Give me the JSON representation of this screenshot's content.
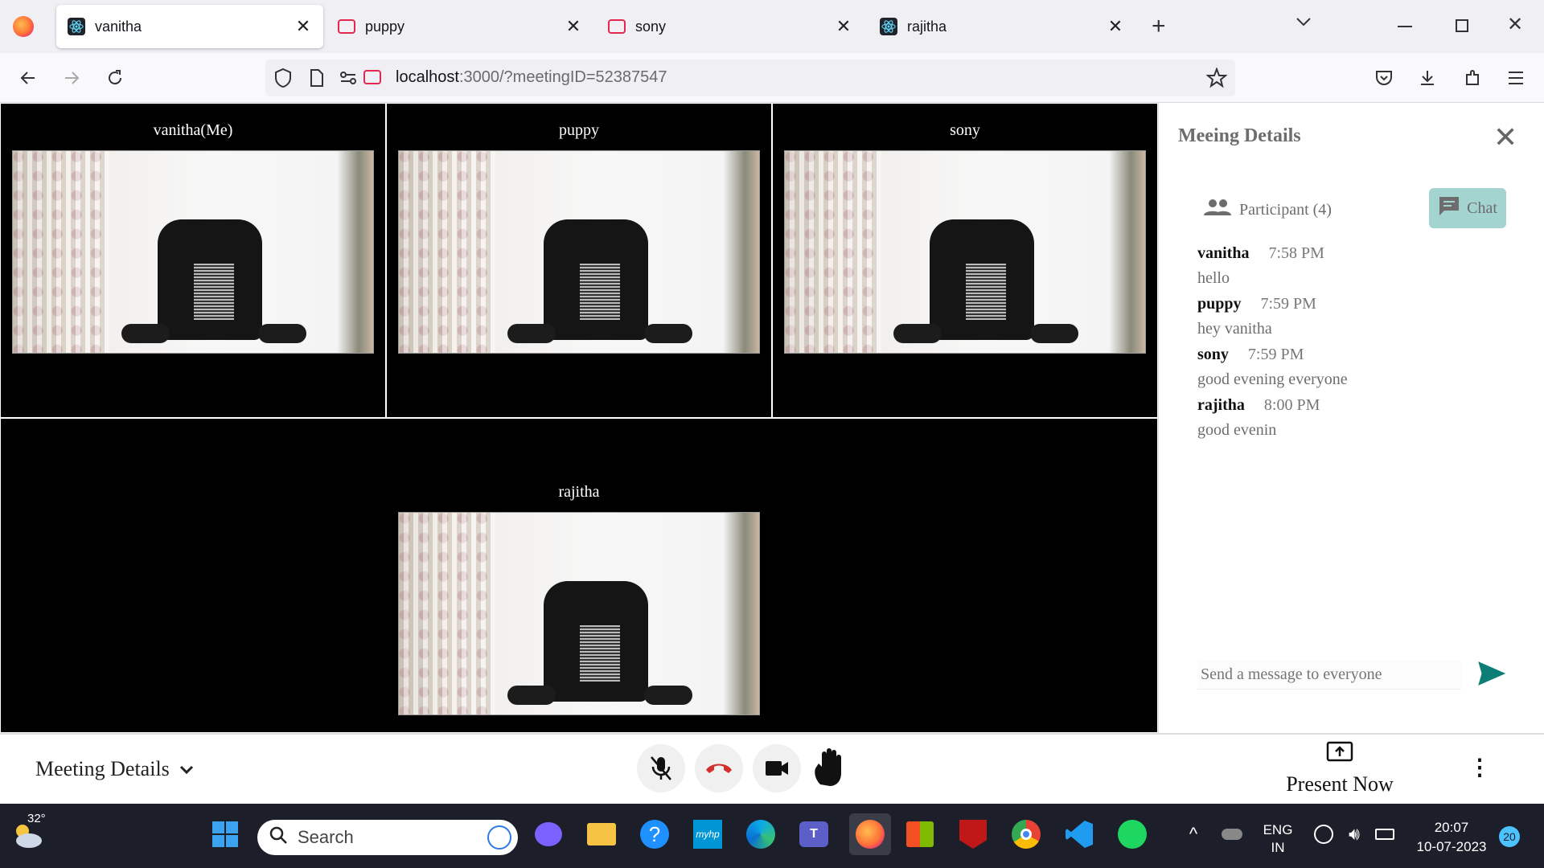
{
  "browser": {
    "tabs": [
      {
        "title": "vanitha",
        "icon": "react-icon",
        "active": true
      },
      {
        "title": "puppy",
        "icon": "camera-icon",
        "active": false
      },
      {
        "title": "sony",
        "icon": "camera-icon",
        "active": false
      },
      {
        "title": "rajitha",
        "icon": "react-icon",
        "active": false
      }
    ],
    "url_host": "localhost",
    "url_rest": ":3000/?meetingID=52387547"
  },
  "stage": {
    "tiles": [
      {
        "name": "vanitha(Me)"
      },
      {
        "name": "puppy"
      },
      {
        "name": "sony"
      },
      {
        "name": "rajitha"
      }
    ]
  },
  "sidebar": {
    "title": "Meeing Details",
    "participants_label": "Participant (4)",
    "chat_label": "Chat",
    "messages": [
      {
        "from": "vanitha",
        "time": "7:58 PM",
        "text": "hello"
      },
      {
        "from": "puppy",
        "time": "7:59 PM",
        "text": "hey vanitha"
      },
      {
        "from": "sony",
        "time": "7:59 PM",
        "text": "good evening everyone"
      },
      {
        "from": "rajitha",
        "time": "8:00 PM",
        "text": "good evenin"
      }
    ],
    "input_placeholder": "Send a message to everyone"
  },
  "bottom": {
    "meeting_details_label": "Meeting Details",
    "present_label": "Present Now"
  },
  "taskbar": {
    "weather_temp": "32°",
    "search_label": "Search",
    "lang_line1": "ENG",
    "lang_line2": "IN",
    "time": "20:07",
    "date": "10-07-2023",
    "notification_count": "20"
  },
  "colors": {
    "accent_teal": "#0d7e76",
    "chat_bg": "#a4d4d0",
    "end_call_red": "#d32f2f"
  }
}
